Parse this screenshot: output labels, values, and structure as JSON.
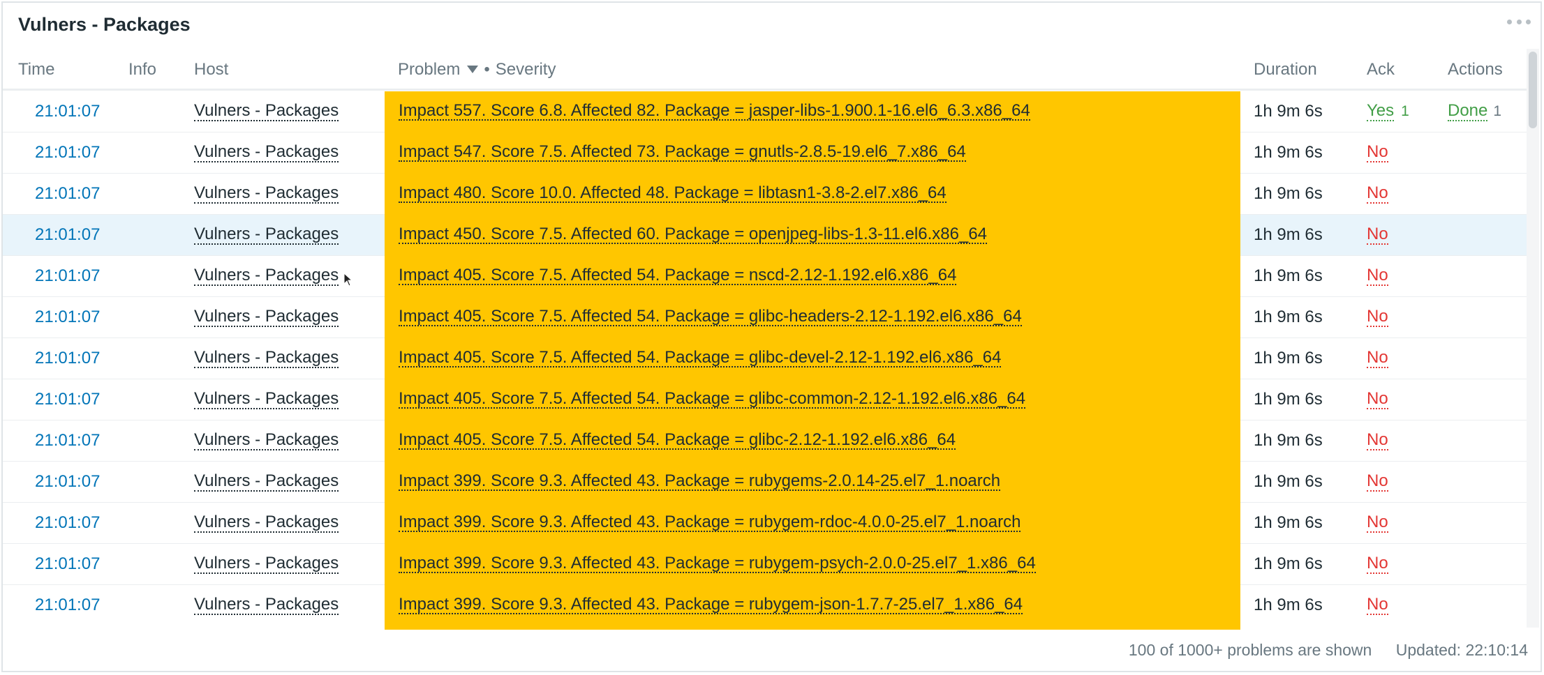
{
  "widget": {
    "title": "Vulners - Packages"
  },
  "columns": {
    "time": "Time",
    "info": "Info",
    "host": "Host",
    "problem": "Problem",
    "separator": "•",
    "severity": "Severity",
    "duration": "Duration",
    "ack": "Ack",
    "actions": "Actions"
  },
  "rows": [
    {
      "time": "21:01:07",
      "host": "Vulners - Packages",
      "problem": "Impact 557. Score 6.8. Affected 82. Package = jasper-libs-1.900.1-16.el6_6.3.x86_64",
      "duration": "1h 9m 6s",
      "ack": "Yes",
      "ack_count": "1",
      "actions": "Done",
      "actions_count": "1"
    },
    {
      "time": "21:01:07",
      "host": "Vulners - Packages",
      "problem": "Impact 547. Score 7.5. Affected 73. Package = gnutls-2.8.5-19.el6_7.x86_64",
      "duration": "1h 9m 6s",
      "ack": "No",
      "ack_count": "",
      "actions": "",
      "actions_count": ""
    },
    {
      "time": "21:01:07",
      "host": "Vulners - Packages",
      "problem": "Impact 480. Score 10.0. Affected 48. Package = libtasn1-3.8-2.el7.x86_64",
      "duration": "1h 9m 6s",
      "ack": "No",
      "ack_count": "",
      "actions": "",
      "actions_count": ""
    },
    {
      "time": "21:01:07",
      "host": "Vulners - Packages",
      "problem": "Impact 450. Score 7.5. Affected 60. Package = openjpeg-libs-1.3-11.el6.x86_64",
      "duration": "1h 9m 6s",
      "ack": "No",
      "ack_count": "",
      "actions": "",
      "actions_count": ""
    },
    {
      "time": "21:01:07",
      "host": "Vulners - Packages",
      "problem": "Impact 405. Score 7.5. Affected 54. Package = nscd-2.12-1.192.el6.x86_64",
      "duration": "1h 9m 6s",
      "ack": "No",
      "ack_count": "",
      "actions": "",
      "actions_count": ""
    },
    {
      "time": "21:01:07",
      "host": "Vulners - Packages",
      "problem": "Impact 405. Score 7.5. Affected 54. Package = glibc-headers-2.12-1.192.el6.x86_64",
      "duration": "1h 9m 6s",
      "ack": "No",
      "ack_count": "",
      "actions": "",
      "actions_count": ""
    },
    {
      "time": "21:01:07",
      "host": "Vulners - Packages",
      "problem": "Impact 405. Score 7.5. Affected 54. Package = glibc-devel-2.12-1.192.el6.x86_64",
      "duration": "1h 9m 6s",
      "ack": "No",
      "ack_count": "",
      "actions": "",
      "actions_count": ""
    },
    {
      "time": "21:01:07",
      "host": "Vulners - Packages",
      "problem": "Impact 405. Score 7.5. Affected 54. Package = glibc-common-2.12-1.192.el6.x86_64",
      "duration": "1h 9m 6s",
      "ack": "No",
      "ack_count": "",
      "actions": "",
      "actions_count": ""
    },
    {
      "time": "21:01:07",
      "host": "Vulners - Packages",
      "problem": "Impact 405. Score 7.5. Affected 54. Package = glibc-2.12-1.192.el6.x86_64",
      "duration": "1h 9m 6s",
      "ack": "No",
      "ack_count": "",
      "actions": "",
      "actions_count": ""
    },
    {
      "time": "21:01:07",
      "host": "Vulners - Packages",
      "problem": "Impact 399. Score 9.3. Affected 43. Package = rubygems-2.0.14-25.el7_1.noarch",
      "duration": "1h 9m 6s",
      "ack": "No",
      "ack_count": "",
      "actions": "",
      "actions_count": ""
    },
    {
      "time": "21:01:07",
      "host": "Vulners - Packages",
      "problem": "Impact 399. Score 9.3. Affected 43. Package = rubygem-rdoc-4.0.0-25.el7_1.noarch",
      "duration": "1h 9m 6s",
      "ack": "No",
      "ack_count": "",
      "actions": "",
      "actions_count": ""
    },
    {
      "time": "21:01:07",
      "host": "Vulners - Packages",
      "problem": "Impact 399. Score 9.3. Affected 43. Package = rubygem-psych-2.0.0-25.el7_1.x86_64",
      "duration": "1h 9m 6s",
      "ack": "No",
      "ack_count": "",
      "actions": "",
      "actions_count": ""
    },
    {
      "time": "21:01:07",
      "host": "Vulners - Packages",
      "problem": "Impact 399. Score 9.3. Affected 43. Package = rubygem-json-1.7.7-25.el7_1.x86_64",
      "duration": "1h 9m 6s",
      "ack": "No",
      "ack_count": "",
      "actions": "",
      "actions_count": ""
    }
  ],
  "highlighted_row_index": 3,
  "footer": {
    "shown": "100 of 1000+ problems are shown",
    "updated": "Updated: 22:10:14"
  },
  "colors": {
    "severity_average": "#ffc600",
    "link_blue": "#0275b8",
    "ack_no": "#e33734",
    "ack_yes": "#429e47",
    "row_highlight": "#e8f4fb"
  },
  "icons": {
    "widget_menu": "ellipsis-icon",
    "sort_indicator": "sort-desc-icon",
    "cursor": "mouse-pointer-icon"
  }
}
